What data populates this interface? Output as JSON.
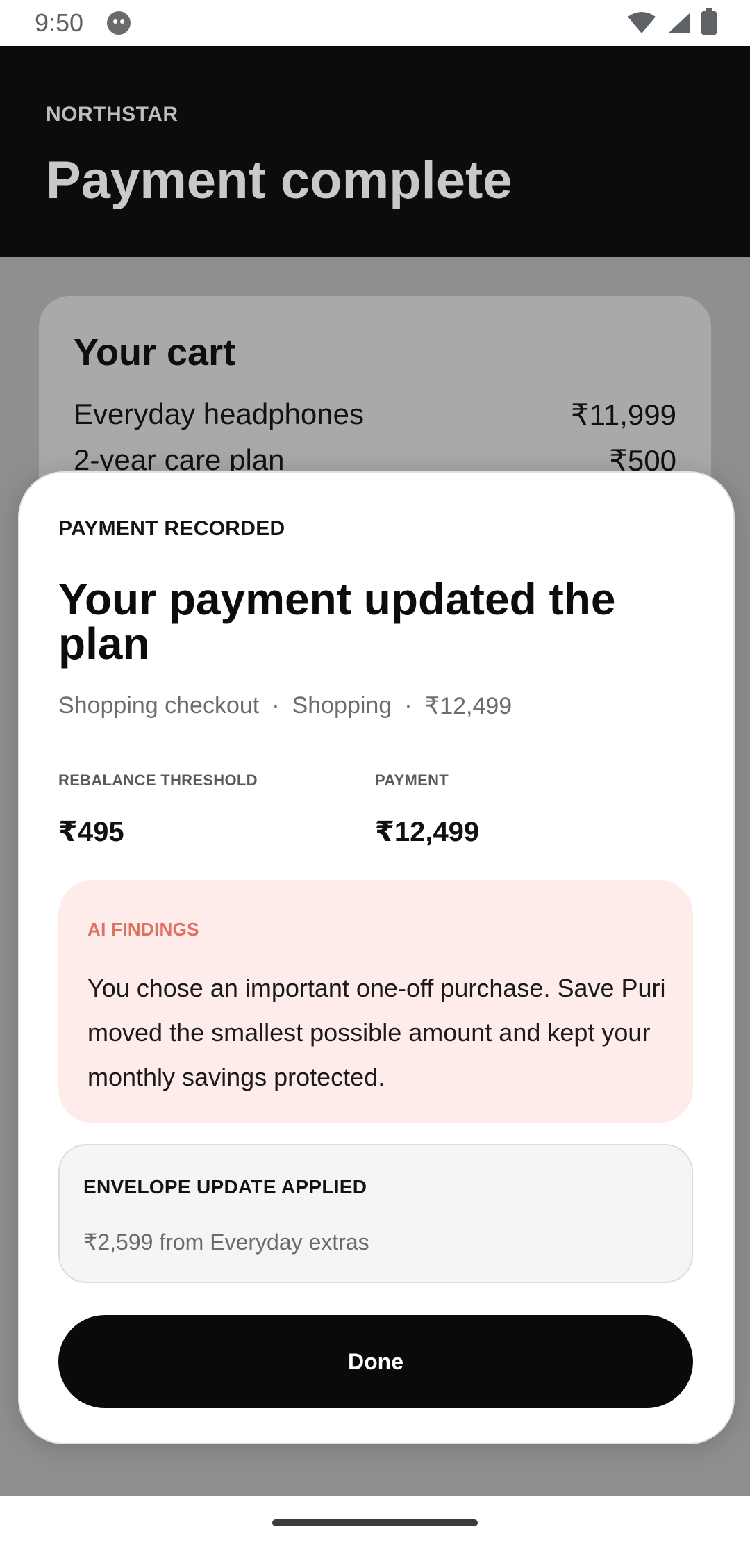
{
  "status_bar": {
    "time": "9:50"
  },
  "header": {
    "brand": "NORTHSTAR",
    "title": "Payment complete"
  },
  "cart": {
    "title": "Your cart",
    "items": [
      {
        "name": "Everyday headphones",
        "price": "₹11,999"
      },
      {
        "name": "2-year care plan",
        "price": "₹500"
      }
    ]
  },
  "sheet": {
    "eyebrow": "PAYMENT RECORDED",
    "title": "Your payment updated the plan",
    "meta": {
      "source": "Shopping checkout",
      "category": "Shopping",
      "amount": "₹12,499",
      "separator": "·"
    },
    "stats": [
      {
        "label": "REBALANCE THRESHOLD",
        "value": "₹495"
      },
      {
        "label": "PAYMENT",
        "value": "₹12,499"
      }
    ],
    "ai": {
      "label": "AI FINDINGS",
      "text": "You chose an important one-off purchase. Save Puri moved the smallest possible amount and kept your monthly savings protected."
    },
    "envelope": {
      "label": "ENVELOPE UPDATE APPLIED",
      "text": "₹2,599 from Everyday extras"
    },
    "done_label": "Done"
  },
  "colors": {
    "header_bg": "#0c0c0c",
    "ai_bg": "#fdecea",
    "ai_accent": "#e07060",
    "button_bg": "#0a0a0a"
  }
}
